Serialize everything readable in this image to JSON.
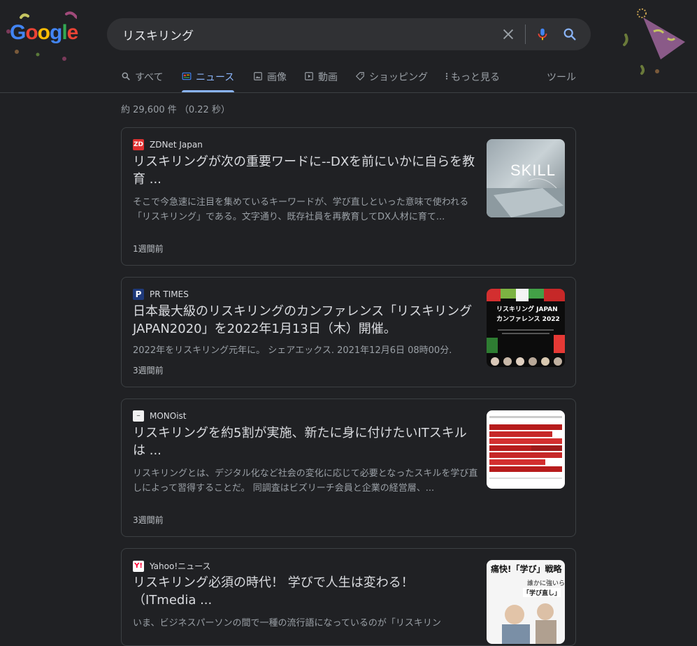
{
  "search": {
    "query": "リスキリング"
  },
  "tabs": [
    {
      "label": "すべて",
      "icon": "search-icon"
    },
    {
      "label": "ニュース",
      "icon": "news-icon"
    },
    {
      "label": "画像",
      "icon": "image-icon"
    },
    {
      "label": "動画",
      "icon": "video-icon"
    },
    {
      "label": "ショッピング",
      "icon": "tag-icon"
    },
    {
      "label": "もっと見る",
      "icon": "more-vert-icon"
    }
  ],
  "tools_label": "ツール",
  "stats": "約 29,600 件 （0.22 秒）",
  "colors": {
    "background": "#202124",
    "accent": "#8ab4f8",
    "card_border": "#3c4043"
  },
  "results": [
    {
      "source": "ZDNet Japan",
      "headline": "リスキリングが次の重要ワードに--DXを前にいかに自らを教育 ...",
      "snippet": "そこで今急速に注目を集めているキーワードが、学び直しといった意味で使われる「リスキリング」である。文字通り、既存社員を再教育してDX人材に育て...",
      "age": "1週間前",
      "thumb_text": "SKILL"
    },
    {
      "source": "PR TIMES",
      "headline": "日本最大級のリスキリングのカンファレンス「リスキリングJAPAN2020」を2022年1月13日（木）開催。",
      "snippet": "2022年をリスキリング元年に。 シェアエックス. 2021年12月6日 08時00分.",
      "age": "3週間前",
      "thumb_title1": "リスキリング JAPAN",
      "thumb_title2": "カンファレンス 2022"
    },
    {
      "source": "MONOist",
      "headline": "リスキリングを約5割が実施、新たに身に付けたいITスキルは ...",
      "snippet": "リスキリングとは、デジタル化など社会の変化に応じて必要となったスキルを学び直しによって習得することだ。 同調査はビズリーチ会員と企業の経営層、...",
      "age": "3週間前"
    },
    {
      "source": "Yahoo!ニュース",
      "headline": "リスキリング必須の時代！ 学びで人生は変わる！（ITmedia ...",
      "snippet": "いま、ビジネスパーソンの間で一種の流行語になっているのが「リスキリン",
      "thumb_title": "痛快!「学び」戦略",
      "thumb_sub1": "誰かに強いら",
      "thumb_sub2": "「学び直し」"
    }
  ]
}
